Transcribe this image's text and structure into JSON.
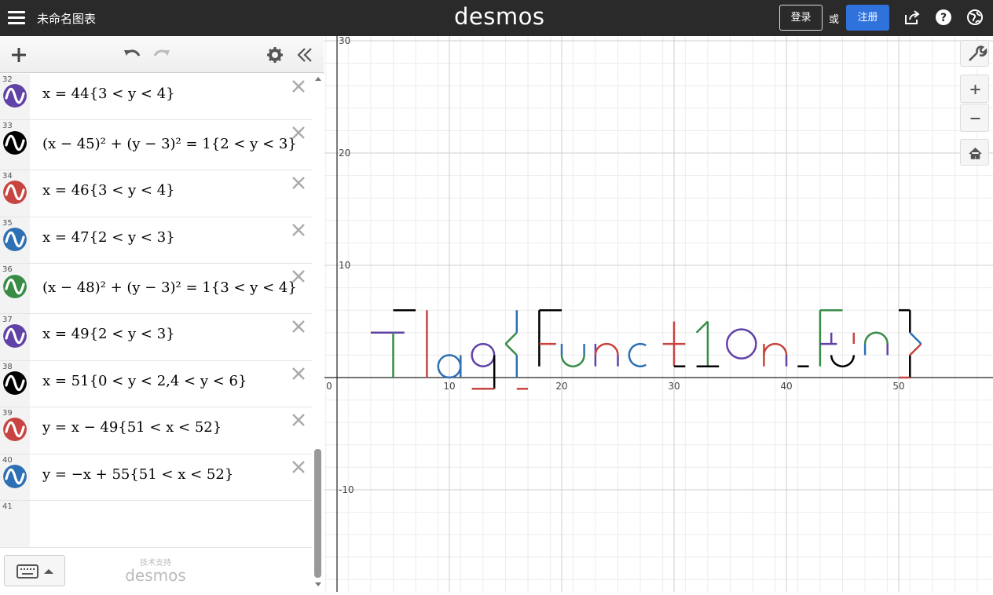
{
  "header": {
    "title": "未命名图表",
    "logo": "desmos",
    "login_label": "登录",
    "or_label": "或",
    "register_label": "注册"
  },
  "colors": {
    "purple": "#6042a6",
    "black": "#000000",
    "red": "#c74440",
    "blue": "#2d70b3",
    "green": "#388c46",
    "topbar": "#2a2a2a",
    "register": "#2f72dc"
  },
  "expressions": [
    {
      "num": "32",
      "color": "purple",
      "latex": "x = 44{3 < y < 4}"
    },
    {
      "num": "33",
      "color": "black",
      "latex": "(x − 45)² + (y − 3)² = 1{2 < y < 3}"
    },
    {
      "num": "34",
      "color": "red",
      "latex": "x = 46{3 < y < 4}"
    },
    {
      "num": "35",
      "color": "blue",
      "latex": "x = 47{2 < y < 3}"
    },
    {
      "num": "36",
      "color": "green",
      "latex": "(x − 48)² + (y − 3)² = 1{3 < y < 4}"
    },
    {
      "num": "37",
      "color": "purple",
      "latex": "x = 49{2 < y < 3}"
    },
    {
      "num": "38",
      "color": "black",
      "latex": "x = 51{0 < y < 2,4 < y < 6}"
    },
    {
      "num": "39",
      "color": "red",
      "latex": "y = x − 49{51 < x < 52}"
    },
    {
      "num": "40",
      "color": "blue",
      "latex": "y = −x + 55{51 < x < 52}"
    },
    {
      "num": "41",
      "color": "",
      "latex": ""
    }
  ],
  "powered_by": {
    "small": "技术支持",
    "logo": "desmos"
  },
  "graph": {
    "x_ticks": [
      "0",
      "10",
      "20",
      "30",
      "40",
      "50"
    ],
    "y_ticks": [
      "30",
      "20",
      "10",
      "-10"
    ],
    "plotted_text": "Flag{Funct10n_Fun}"
  },
  "icons": [
    "menu-icon",
    "share-icon",
    "help-icon",
    "globe-icon",
    "add-icon",
    "undo-icon",
    "redo-icon",
    "settings-icon",
    "collapse-icon",
    "wrench-icon",
    "zoom-in-icon",
    "zoom-out-icon",
    "home-icon",
    "keyboard-icon"
  ]
}
